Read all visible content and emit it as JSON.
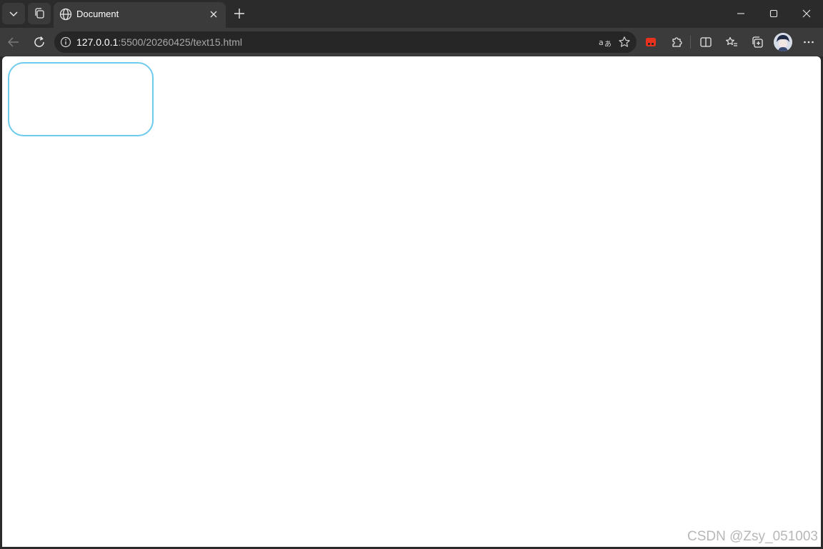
{
  "browser": {
    "tab": {
      "title": "Document",
      "favicon": "globe-icon"
    },
    "address_bar": {
      "url_host": "127.0.0.1",
      "url_rest": ":5500/20260425/text15.html"
    },
    "icons": {
      "tab_actions": "chevron-down-icon",
      "workspaces": "workspaces-icon",
      "close_tab": "close-icon",
      "new_tab": "plus-icon",
      "minimize": "minimize-icon",
      "maximize": "maximize-icon",
      "close_window": "close-icon",
      "back": "back-arrow-icon",
      "refresh": "refresh-icon",
      "site_info": "info-icon",
      "read_aloud_translate": "translate-icon",
      "favorite": "star-icon",
      "extension_red": "extension-icon",
      "extensions": "puzzle-icon",
      "split_screen": "split-screen-icon",
      "favorites": "favorites-list-icon",
      "collections": "collections-icon",
      "profile": "avatar",
      "more": "more-icon"
    },
    "colors": {
      "chrome_dark": "#2b2b2b",
      "toolbar": "#3b3b3b",
      "extension_red": "#e8321e"
    }
  },
  "page": {
    "box_border_color": "#6ecbee",
    "watermark": "CSDN @Zsy_051003"
  }
}
